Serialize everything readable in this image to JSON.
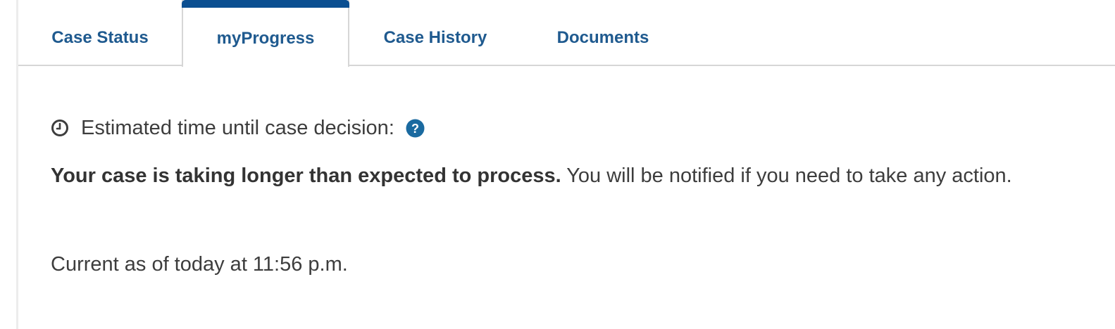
{
  "tabs": [
    {
      "label": "Case Status",
      "active": false
    },
    {
      "label": "myProgress",
      "active": true
    },
    {
      "label": "Case History",
      "active": false
    },
    {
      "label": "Documents",
      "active": false
    }
  ],
  "estimate": {
    "icon": "clock-icon",
    "label": "Estimated time until case decision:",
    "help_icon": "question-circle-icon"
  },
  "status": {
    "bold": "Your case is taking longer than expected to process.",
    "rest": " You will be notified if you need to take any action."
  },
  "current_as_of": "Current as of today at 11:56 p.m.",
  "colors": {
    "tab_text": "#1f5a8f",
    "active_tab_accent": "#0b4f91",
    "help_icon": "#1a6aa0",
    "body_text": "#3d3d3d"
  }
}
